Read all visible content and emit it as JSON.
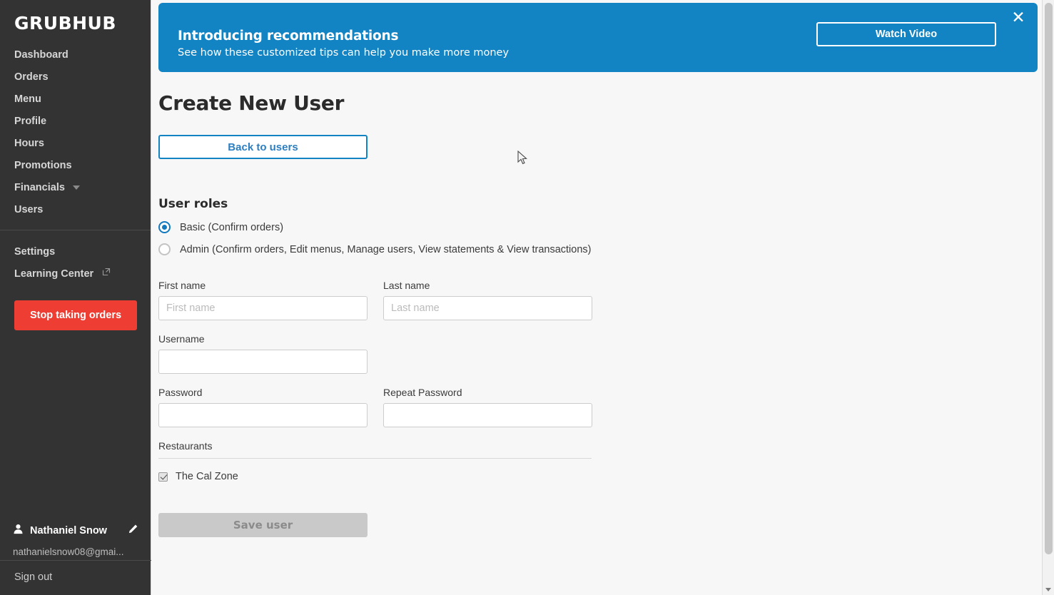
{
  "sidebar": {
    "brand": "GRUBHUB",
    "nav_items": [
      {
        "label": "Dashboard",
        "icon": ""
      },
      {
        "label": "Orders",
        "icon": ""
      },
      {
        "label": "Menu",
        "icon": ""
      },
      {
        "label": "Profile",
        "icon": ""
      },
      {
        "label": "Hours",
        "icon": ""
      },
      {
        "label": "Promotions",
        "icon": ""
      },
      {
        "label": "Financials",
        "icon": "chevron-down-icon"
      },
      {
        "label": "Users",
        "icon": ""
      }
    ],
    "secondary_items": [
      {
        "label": "Settings",
        "icon": ""
      },
      {
        "label": "Learning Center",
        "icon": "external-link-icon"
      }
    ],
    "stop_orders_label": "Stop taking orders",
    "stop_orders_color": "#ee3e33",
    "user": {
      "name": "Nathaniel Snow",
      "email": "nathanielsnow08@gmai...",
      "avatar_icon": "person-icon",
      "edit_icon": "pencil-icon"
    },
    "sign_out_label": "Sign out",
    "background_color": "#333333"
  },
  "banner": {
    "title": "Introducing recommendations",
    "subtitle": "See how these customized tips can help you make more money",
    "cta_label": "Watch Video",
    "close_icon": "close-icon",
    "background_color": "#1283c3"
  },
  "main": {
    "page_title": "Create New User",
    "back_button_label": "Back to users",
    "accent_color": "#1283c3",
    "user_roles": {
      "section_label": "User roles",
      "options": [
        {
          "label": "Basic (Confirm orders)",
          "selected": true
        },
        {
          "label": "Admin (Confirm orders, Edit menus, Manage users, View statements & View transactions)",
          "selected": false
        }
      ]
    },
    "fields": {
      "first_name": {
        "label": "First name",
        "placeholder": "First name",
        "value": ""
      },
      "last_name": {
        "label": "Last name",
        "placeholder": "Last name",
        "value": ""
      },
      "username": {
        "label": "Username",
        "placeholder": "",
        "value": ""
      },
      "password": {
        "label": "Password",
        "placeholder": "",
        "value": ""
      },
      "repeat_password": {
        "label": "Repeat Password",
        "placeholder": "",
        "value": ""
      }
    },
    "restaurants": {
      "label": "Restaurants",
      "items": [
        {
          "label": "The Cal Zone",
          "checked": true
        }
      ]
    },
    "save_button_label": "Save user",
    "save_button_disabled": true
  }
}
